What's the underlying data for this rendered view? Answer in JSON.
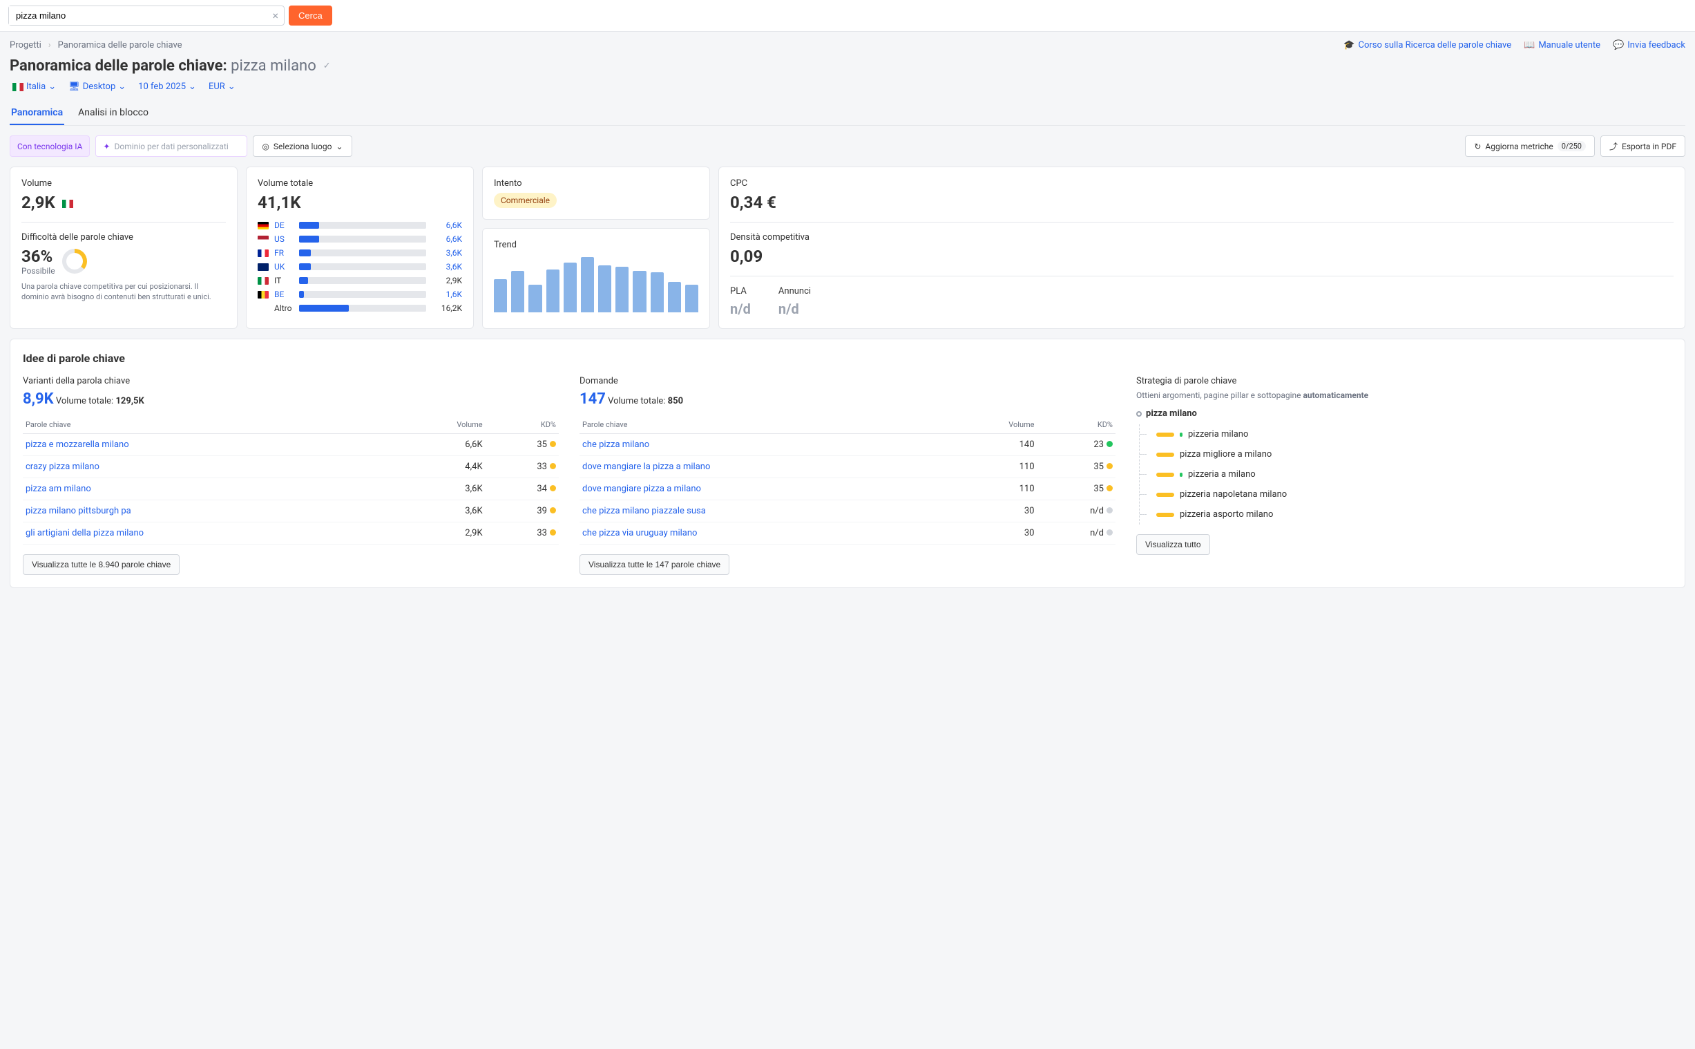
{
  "search": {
    "value": "pizza milano",
    "button": "Cerca"
  },
  "breadcrumbs": {
    "root": "Progetti",
    "current": "Panoramica delle parole chiave"
  },
  "help": {
    "course": "Corso sulla Ricerca delle parole chiave",
    "manual": "Manuale utente",
    "feedback": "Invia feedback"
  },
  "title": {
    "prefix": "Panoramica delle parole chiave:",
    "keyword": "pizza milano"
  },
  "filters": {
    "country": "Italia",
    "device": "Desktop",
    "date": "10 feb 2025",
    "currency": "EUR"
  },
  "tabs": {
    "overview": "Panoramica",
    "bulk": "Analisi in blocco"
  },
  "toolbar": {
    "ai_badge": "Con tecnologia IA",
    "domain_placeholder": "Dominio per dati personalizzati",
    "location": "Seleziona luogo",
    "refresh": "Aggiorna metriche",
    "refresh_count": "0/250",
    "export": "Esporta in PDF"
  },
  "volume": {
    "label": "Volume",
    "value": "2,9K"
  },
  "kd": {
    "label": "Difficoltà delle parole chiave",
    "value": "36%",
    "status": "Possibile",
    "note": "Una parola chiave competitiva per cui posizionarsi. Il dominio avrà bisogno di contenuti ben strutturati e unici."
  },
  "total_volume": {
    "label": "Volume totale",
    "value": "41,1K",
    "rows": [
      {
        "cc": "DE",
        "flag": "flag-de",
        "val": "6,6K",
        "pct": 16,
        "link": true
      },
      {
        "cc": "US",
        "flag": "flag-us",
        "val": "6,6K",
        "pct": 16,
        "link": true
      },
      {
        "cc": "FR",
        "flag": "flag-fr",
        "val": "3,6K",
        "pct": 9,
        "link": true
      },
      {
        "cc": "UK",
        "flag": "flag-uk",
        "val": "3,6K",
        "pct": 9,
        "link": true
      },
      {
        "cc": "IT",
        "flag": "flag-it2",
        "val": "2,9K",
        "pct": 7,
        "link": false
      },
      {
        "cc": "BE",
        "flag": "flag-be",
        "val": "1,6K",
        "pct": 4,
        "link": true
      }
    ],
    "other_label": "Altro",
    "other_val": "16,2K",
    "other_pct": 39
  },
  "intent": {
    "label": "Intento",
    "value": "Commerciale"
  },
  "trend": {
    "label": "Trend",
    "bars": [
      60,
      75,
      50,
      78,
      90,
      100,
      85,
      82,
      75,
      72,
      55,
      50
    ]
  },
  "cpc": {
    "label": "CPC",
    "value": "0,34 €"
  },
  "density": {
    "label": "Densità competitiva",
    "value": "0,09"
  },
  "pla": {
    "label": "PLA",
    "value": "n/d"
  },
  "ads": {
    "label": "Annunci",
    "value": "n/d"
  },
  "ideas": {
    "title": "Idee di parole chiave",
    "variants": {
      "title": "Varianti della parola chiave",
      "count": "8,9K",
      "total_label": "Volume totale:",
      "total": "129,5K",
      "th1": "Parole chiave",
      "th2": "Volume",
      "th3": "KD%",
      "rows": [
        {
          "kw": "pizza e mozzarella milano",
          "vol": "6,6K",
          "kd": "35",
          "dot": "dot-o"
        },
        {
          "kw": "crazy pizza milano",
          "vol": "4,4K",
          "kd": "33",
          "dot": "dot-o"
        },
        {
          "kw": "pizza am milano",
          "vol": "3,6K",
          "kd": "34",
          "dot": "dot-o"
        },
        {
          "kw": "pizza milano pittsburgh pa",
          "vol": "3,6K",
          "kd": "39",
          "dot": "dot-o"
        },
        {
          "kw": "gli artigiani della pizza milano",
          "vol": "2,9K",
          "kd": "33",
          "dot": "dot-o"
        }
      ],
      "button": "Visualizza tutte le 8.940 parole chiave"
    },
    "questions": {
      "title": "Domande",
      "count": "147",
      "total_label": "Volume totale:",
      "total": "850",
      "th1": "Parole chiave",
      "th2": "Volume",
      "th3": "KD%",
      "rows": [
        {
          "kw": "che pizza milano",
          "vol": "140",
          "kd": "23",
          "dot": "dot-g"
        },
        {
          "kw": "dove mangiare la pizza a milano",
          "vol": "110",
          "kd": "35",
          "dot": "dot-o"
        },
        {
          "kw": "dove mangiare pizza a milano",
          "vol": "110",
          "kd": "35",
          "dot": "dot-o"
        },
        {
          "kw": "che pizza milano piazzale susa",
          "vol": "30",
          "kd": "n/d",
          "dot": "dot-gr"
        },
        {
          "kw": "che pizza via uruguay milano",
          "vol": "30",
          "kd": "n/d",
          "dot": "dot-gr"
        }
      ],
      "button": "Visualizza tutte le 147 parole chiave"
    },
    "strategy": {
      "title": "Strategia di parole chiave",
      "subtitle_a": "Ottieni argomenti, pagine pillar e sottopagine ",
      "subtitle_b": "automaticamente",
      "root": "pizza milano",
      "items": [
        {
          "label": "pizzeria milano",
          "green": true
        },
        {
          "label": "pizza migliore a milano",
          "green": false
        },
        {
          "label": "pizzeria a milano",
          "green": true
        },
        {
          "label": "pizzeria napoletana milano",
          "green": false
        },
        {
          "label": "pizzeria asporto milano",
          "green": false
        }
      ],
      "button": "Visualizza tutto"
    }
  }
}
